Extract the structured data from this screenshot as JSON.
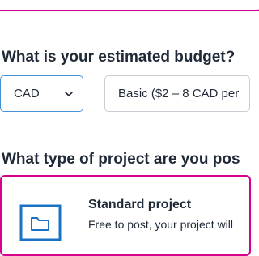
{
  "budget": {
    "heading": "What is your estimated budget?",
    "currency_value": "CAD",
    "range_value": "Basic ($2 – 8 CAD per"
  },
  "project": {
    "heading": "What type of project are you pos",
    "card": {
      "title": "Standard project",
      "description": "Free to post, your project will",
      "icon": "folder-icon"
    }
  },
  "colors": {
    "accent_border": "#d4008f",
    "focus_border": "#4a90d9",
    "icon_blue": "#1a72c4"
  }
}
